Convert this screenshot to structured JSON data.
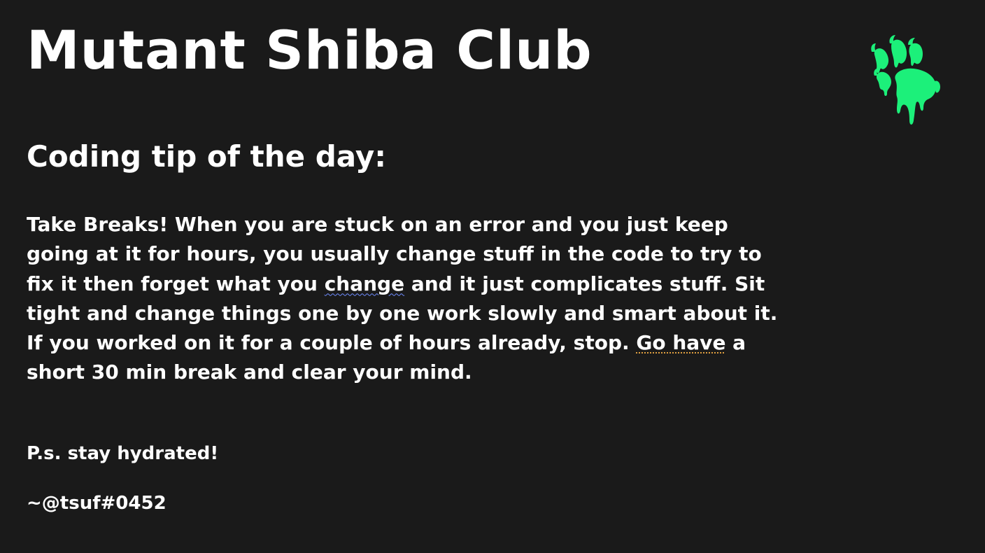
{
  "slide": {
    "title": "Mutant Shiba Club",
    "subtitle": "Coding tip of the day:",
    "tip_segments": [
      "Take Breaks! When you are stuck on an error and you just keep going at it for hours, you usually change stuff in the code to try to fix it then forget what you ",
      "change",
      " and it just complicates stuff. Sit tight and change things one by one work slowly and smart about it. If you worked on it for a couple of hours already, stop. ",
      "Go have",
      " a short 30 min break and clear your mind."
    ],
    "postscript": "P.s. stay hydrated!",
    "signature": "~@tsuf#0452"
  },
  "logo": {
    "icon": "paw-icon",
    "color": "#1cf07a"
  },
  "colors": {
    "background": "#1a1a1a",
    "text": "#ffffff",
    "spell_underline": "#6f8cff",
    "grammar_underline": "#e0a040"
  }
}
